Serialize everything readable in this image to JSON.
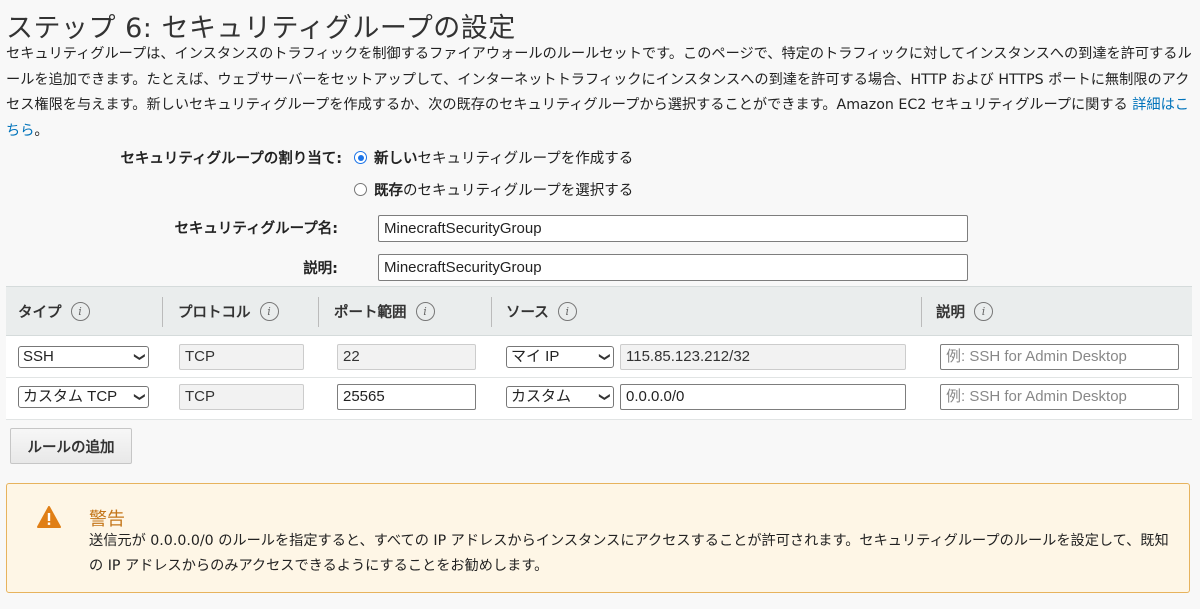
{
  "page": {
    "title": "ステップ 6: セキュリティグループの設定",
    "description": "セキュリティグループは、インスタンスのトラフィックを制御するファイアウォールのルールセットです。このページで、特定のトラフィックに対してインスタンスへの到達を許可するルールを追加できます。たとえば、ウェブサーバーをセットアップして、インターネットトラフィックにインスタンスへの到達を許可する場合、HTTP および HTTPS ポートに無制限のアクセス権限を与えます。新しいセキュリティグループを作成するか、次の既存のセキュリティグループから選択することができます。Amazon EC2 セキュリティグループに関する ",
    "learn_more": "詳細はこちら",
    "description_end": "。"
  },
  "assignment": {
    "label": "セキュリティグループの割り当て:",
    "options": [
      {
        "bold": "新しい",
        "rest": "セキュリティグループを作成する",
        "selected": true
      },
      {
        "bold": "既存",
        "rest": "のセキュリティグループを選択する",
        "selected": false
      }
    ]
  },
  "group_name": {
    "label": "セキュリティグループ名:",
    "value": "MinecraftSecurityGroup"
  },
  "group_desc": {
    "label": "説明:",
    "value": "MinecraftSecurityGroup"
  },
  "table": {
    "headers": [
      "タイプ",
      "プロトコル",
      "ポート範囲",
      "ソース",
      "説明"
    ],
    "rows": [
      {
        "type": "SSH",
        "protocol": "TCP",
        "port": "22",
        "source_type": "マイ IP",
        "source": "115.85.123.212/32",
        "desc_placeholder": "例: SSH for Admin Desktop"
      },
      {
        "type": "カスタム TCP",
        "protocol": "TCP",
        "port": "25565",
        "source_type": "カスタム",
        "source": "0.0.0.0/0",
        "desc_placeholder": "例: SSH for Admin Desktop"
      }
    ]
  },
  "add_rule_label": "ルールの追加",
  "warning": {
    "title": "警告",
    "body": "送信元が 0.0.0.0/0 のルールを指定すると、すべての IP アドレスからインスタンスにアクセスすることが許可されます。セキュリティグループのルールを設定して、既知の IP アドレスからのみアクセスできるようにすることをお勧めします。",
    "icon": "warning-triangle-icon",
    "accent": "#e07f16"
  }
}
